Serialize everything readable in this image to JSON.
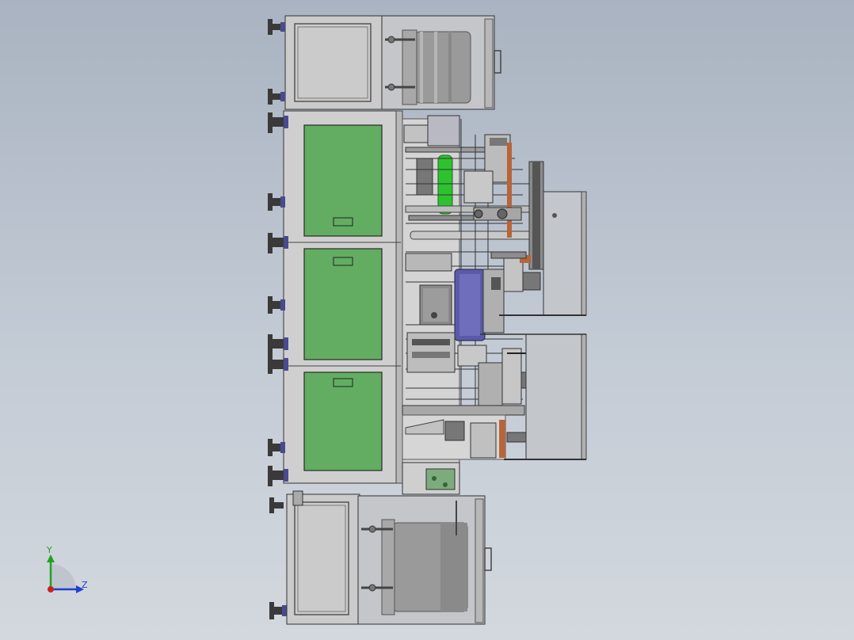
{
  "triad": {
    "y_label": "Y",
    "z_label": "Z"
  },
  "colors": {
    "background_top": "#a9b3c1",
    "background_bottom": "#d3d8de",
    "frame_grey": "#c8c8c8",
    "edge_dark": "#3a3a3a",
    "panel_green": "#62ad62",
    "cylinder_green": "#2fc22f",
    "rotary_blue": "#5a5aa8",
    "roll_grey": "#9a9a9a",
    "axis_y": "#22a022",
    "axis_z": "#2040d0",
    "axis_x": "#cc2020"
  }
}
